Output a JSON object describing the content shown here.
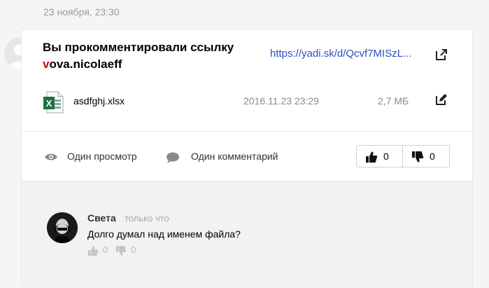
{
  "event": {
    "date": "23 ноября, 23:30"
  },
  "card": {
    "title_line1": "Вы прокомментировали ссылку",
    "title_first_letter": "v",
    "title_user_rest": "ova.nicolaeff",
    "link_text": "https://yadi.sk/d/Qcvf7MISzL...",
    "file": {
      "name": "asdfghj.xlsx",
      "date": "2016.11.23 23:29",
      "size": "2,7 МБ"
    },
    "stats": {
      "views": "Один просмотр",
      "comments": "Один комментарий"
    },
    "votes": {
      "likes": "0",
      "dislikes": "0"
    }
  },
  "comment": {
    "author": "Света",
    "time": "только что",
    "text": "Долго думал над именем файла?",
    "likes": "0",
    "dislikes": "0"
  },
  "colors": {
    "link": "#2a52be",
    "accent_red": "#d50000",
    "excel_green": "#1e7145"
  }
}
